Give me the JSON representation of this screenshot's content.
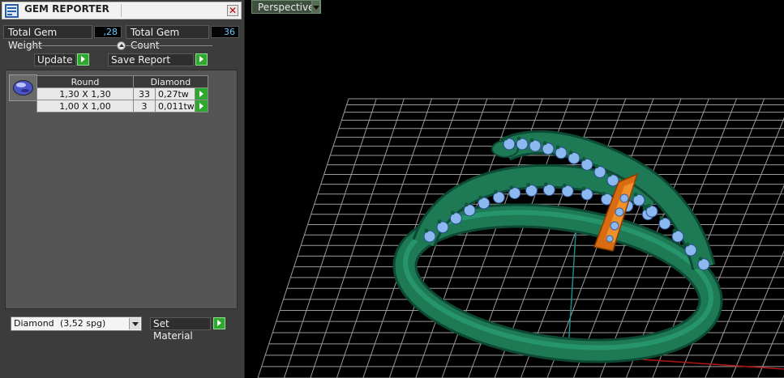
{
  "panel": {
    "title": "GEM REPORTER",
    "close_glyph": "✕",
    "total_weight_label": "Total Gem Weight",
    "total_weight_value": ",28",
    "total_count_label": "Total Gem Count",
    "total_count_value": "36",
    "update_label": "Update",
    "save_report_label": "Save Report",
    "table": {
      "headers": [
        "Round",
        "Diamond"
      ],
      "rows": [
        {
          "size": "1,30 X 1,30",
          "count": "33",
          "weight": "0,27tw"
        },
        {
          "size": "1,00 X 1,00",
          "count": "3",
          "weight": "0,011tw"
        }
      ]
    },
    "material": {
      "name": "Diamond",
      "spg": "(3,52 spg)"
    },
    "set_material_label": "Set Material"
  },
  "viewport": {
    "view_label": "Perspective"
  },
  "colors": {
    "panel_bg": "#3c3c3c",
    "value_text": "#6ec6ff",
    "go_button": "#2fa82f",
    "metal_green": "#1d7a55",
    "gem_blue": "#8cb8f0",
    "setting_orange": "#e07a1c",
    "grid": "#9a9a9a"
  },
  "icons": [
    "app-icon",
    "close-icon",
    "collapse-icon",
    "play-arrow-icon",
    "dropdown-arrow-icon",
    "gem-round-icon"
  ]
}
